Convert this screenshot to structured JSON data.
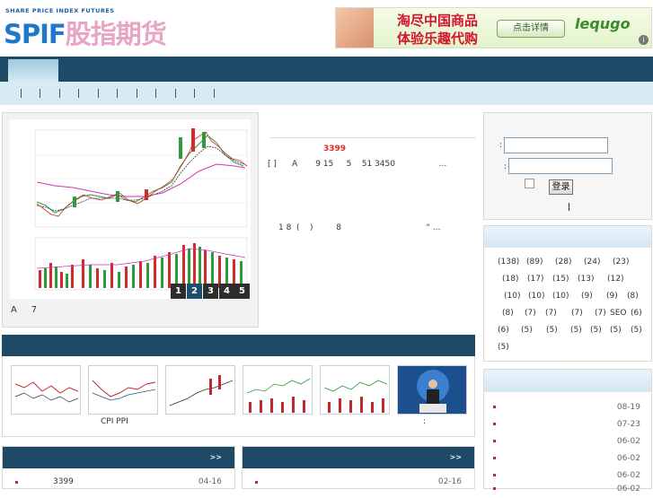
{
  "header": {
    "logo_small": "SHARE PRICE INDEX FUTURES",
    "logo_big": "SPIF",
    "logo_cn": "股指期货",
    "ad": {
      "line1": "淘尽中国商品",
      "line2": "体验乐趣代购",
      "button": "点击详情",
      "brand": "lequgo",
      "info": "i"
    }
  },
  "slideshow": {
    "pages": [
      "1",
      "2",
      "3",
      "4",
      "5"
    ],
    "active_page": "2",
    "caption": "A     7"
  },
  "headline": {
    "title": "3399",
    "summary": "[ ]      A       9 15     5    51 3450                 ...",
    "summary2": "1 8  (    )         8                                 “ ..."
  },
  "login": {
    "user_label": ":",
    "pass_label": ":",
    "submit": "登录",
    "divider": "|"
  },
  "tags": [
    "(138)",
    "(89)",
    "(28)",
    "(24)",
    "(23)",
    "(18)",
    "(17)",
    "(15)",
    "(13)",
    "(12)",
    "(10)",
    "(10)",
    "(10)",
    "(9)",
    "(9)",
    "(8)",
    "(8)",
    "(7)",
    "(7)",
    "(7)",
    "(7)",
    "SEO",
    "(6)",
    "(6)",
    "(5)",
    "(5)",
    "(5)",
    "(5)",
    "(5)",
    "(5)",
    "(5)"
  ],
  "right_news": {
    "dates": [
      "08-19",
      "07-23",
      "06-02",
      "06-02",
      "06-02",
      "06-02"
    ]
  },
  "strip": {
    "captions": [
      "CPI PPI",
      ":"
    ]
  },
  "news_left": {
    "more": ">>",
    "title": "3399",
    "date": "04-16"
  },
  "news_mid": {
    "more": ">>",
    "title": "",
    "date": "02-16"
  },
  "colors": {
    "nav": "#1e4a68",
    "subnav": "#d8ebf3",
    "headline": "#e3242b"
  }
}
